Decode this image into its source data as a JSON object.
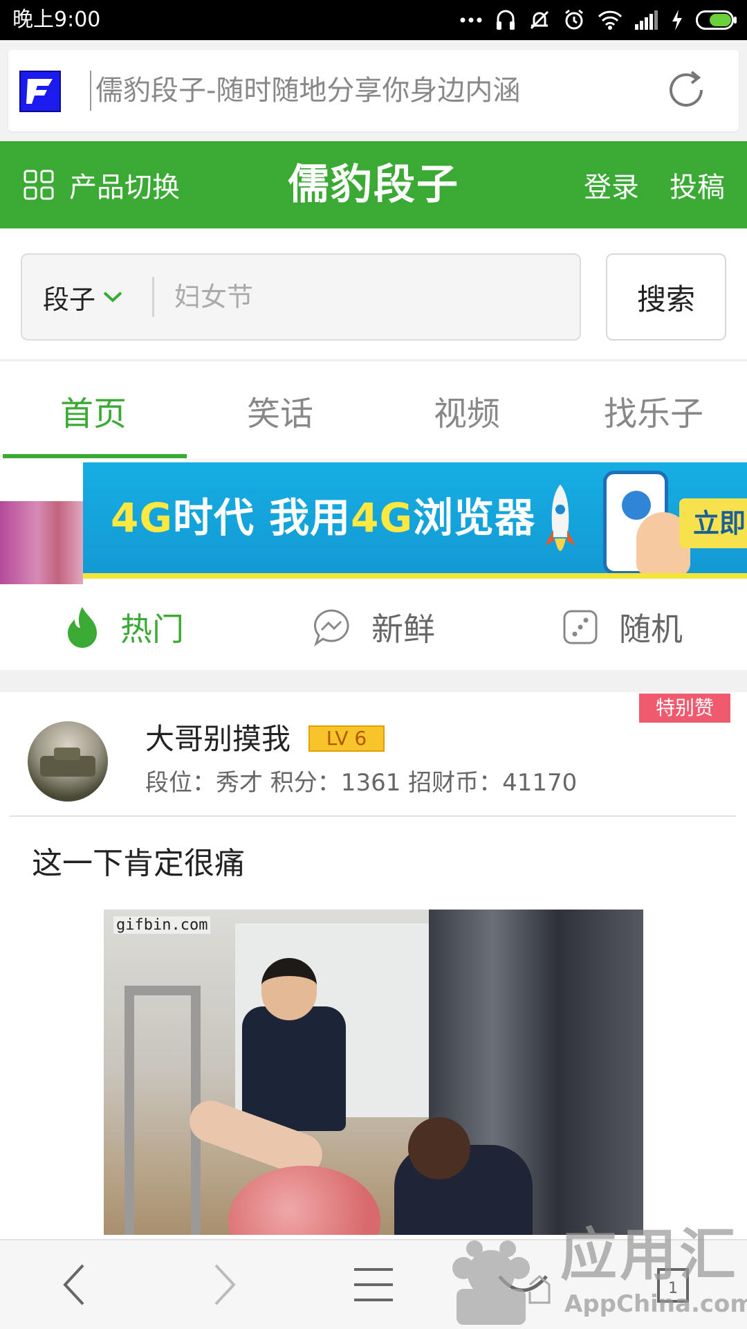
{
  "status_bar": {
    "time": "晚上9:00",
    "icons": [
      "more-dots-icon",
      "headset-icon",
      "mute-bell-icon",
      "alarm-icon",
      "wifi-icon",
      "signal-icon",
      "charging-bolt-icon",
      "battery-icon"
    ]
  },
  "address_bar": {
    "site_icon": "site-favicon",
    "url_text": "儒豹段子-随时随地分享你身边内涵",
    "refresh_icon": "refresh-icon"
  },
  "header": {
    "product_switch_label": "产品切换",
    "product_switch_icon": "grid-icon",
    "logo_text": "儒豹段子",
    "login_label": "登录",
    "submit_label": "投稿",
    "color": "#3aaa35"
  },
  "search": {
    "category": "段子",
    "placeholder": "妇女节",
    "button_label": "搜索"
  },
  "main_tabs": [
    {
      "label": "首页",
      "active": true
    },
    {
      "label": "笑话",
      "active": false
    },
    {
      "label": "视频",
      "active": false
    },
    {
      "label": "找乐子",
      "active": false
    }
  ],
  "banner": {
    "text_part1": "4G",
    "text_part2": "时代  我用",
    "text_part3": "4G",
    "text_part4": "浏览器",
    "cta_label": "立即"
  },
  "sub_tabs": [
    {
      "label": "热门",
      "icon": "flame-icon",
      "active": true
    },
    {
      "label": "新鲜",
      "icon": "messenger-bolt-icon",
      "active": false
    },
    {
      "label": "随机",
      "icon": "dice-icon",
      "active": false
    }
  ],
  "post": {
    "badge": "特别赞",
    "username": "大哥别摸我",
    "level": "LV 6",
    "stats": "段位：秀才  积分：1361  招财币：41170",
    "title": "这一下肯定很痛",
    "image_watermark": "gifbin.com"
  },
  "bottom_toolbar": {
    "items": [
      "back-icon",
      "forward-icon",
      "menu-icon",
      "home-smile-icon",
      "tabs-icon"
    ],
    "tab_count": "1"
  },
  "overlay_watermark": {
    "title": "应用汇",
    "subtitle": "AppChina.com"
  }
}
